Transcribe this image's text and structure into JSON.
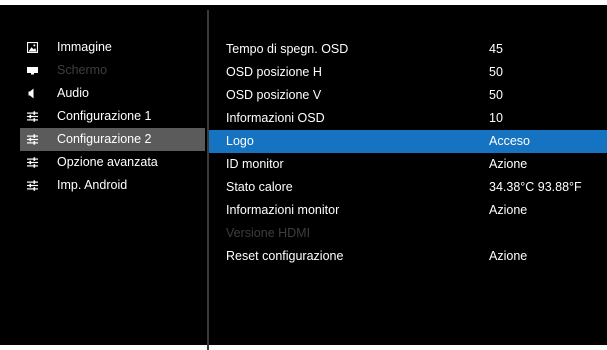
{
  "sidebar": {
    "items": [
      {
        "label": "Immagine",
        "icon": "image-icon",
        "state": "normal"
      },
      {
        "label": "Schermo",
        "icon": "screen-icon",
        "state": "disabled"
      },
      {
        "label": "Audio",
        "icon": "speaker-icon",
        "state": "normal"
      },
      {
        "label": "Configurazione 1",
        "icon": "sliders-icon",
        "state": "normal"
      },
      {
        "label": "Configurazione 2",
        "icon": "sliders-icon",
        "state": "selected"
      },
      {
        "label": "Opzione avanzata",
        "icon": "sliders-icon",
        "state": "normal"
      },
      {
        "label": "Imp. Android",
        "icon": "sliders-icon",
        "state": "normal"
      }
    ]
  },
  "settings": {
    "rows": [
      {
        "label": "Tempo di spegn. OSD",
        "value": "45",
        "state": "normal"
      },
      {
        "label": "OSD posizione H",
        "value": "50",
        "state": "normal"
      },
      {
        "label": "OSD posizione V",
        "value": "50",
        "state": "normal"
      },
      {
        "label": "Informazioni OSD",
        "value": "10",
        "state": "normal"
      },
      {
        "label": "Logo",
        "value": "Acceso",
        "state": "selected"
      },
      {
        "label": "ID monitor",
        "value": "Azione",
        "state": "normal"
      },
      {
        "label": "Stato calore",
        "value": "34.38°C 93.88°F",
        "state": "normal"
      },
      {
        "label": "Informazioni monitor",
        "value": "Azione",
        "state": "normal"
      },
      {
        "label": "Versione HDMI",
        "value": "",
        "state": "disabled"
      },
      {
        "label": "Reset configurazione",
        "value": "Azione",
        "state": "normal"
      }
    ]
  },
  "colors": {
    "background": "#000000",
    "selected_sidebar": "#5b5b5b",
    "selected_row": "#1673c2",
    "disabled_text": "#3e3e3e",
    "text": "#ffffff"
  }
}
